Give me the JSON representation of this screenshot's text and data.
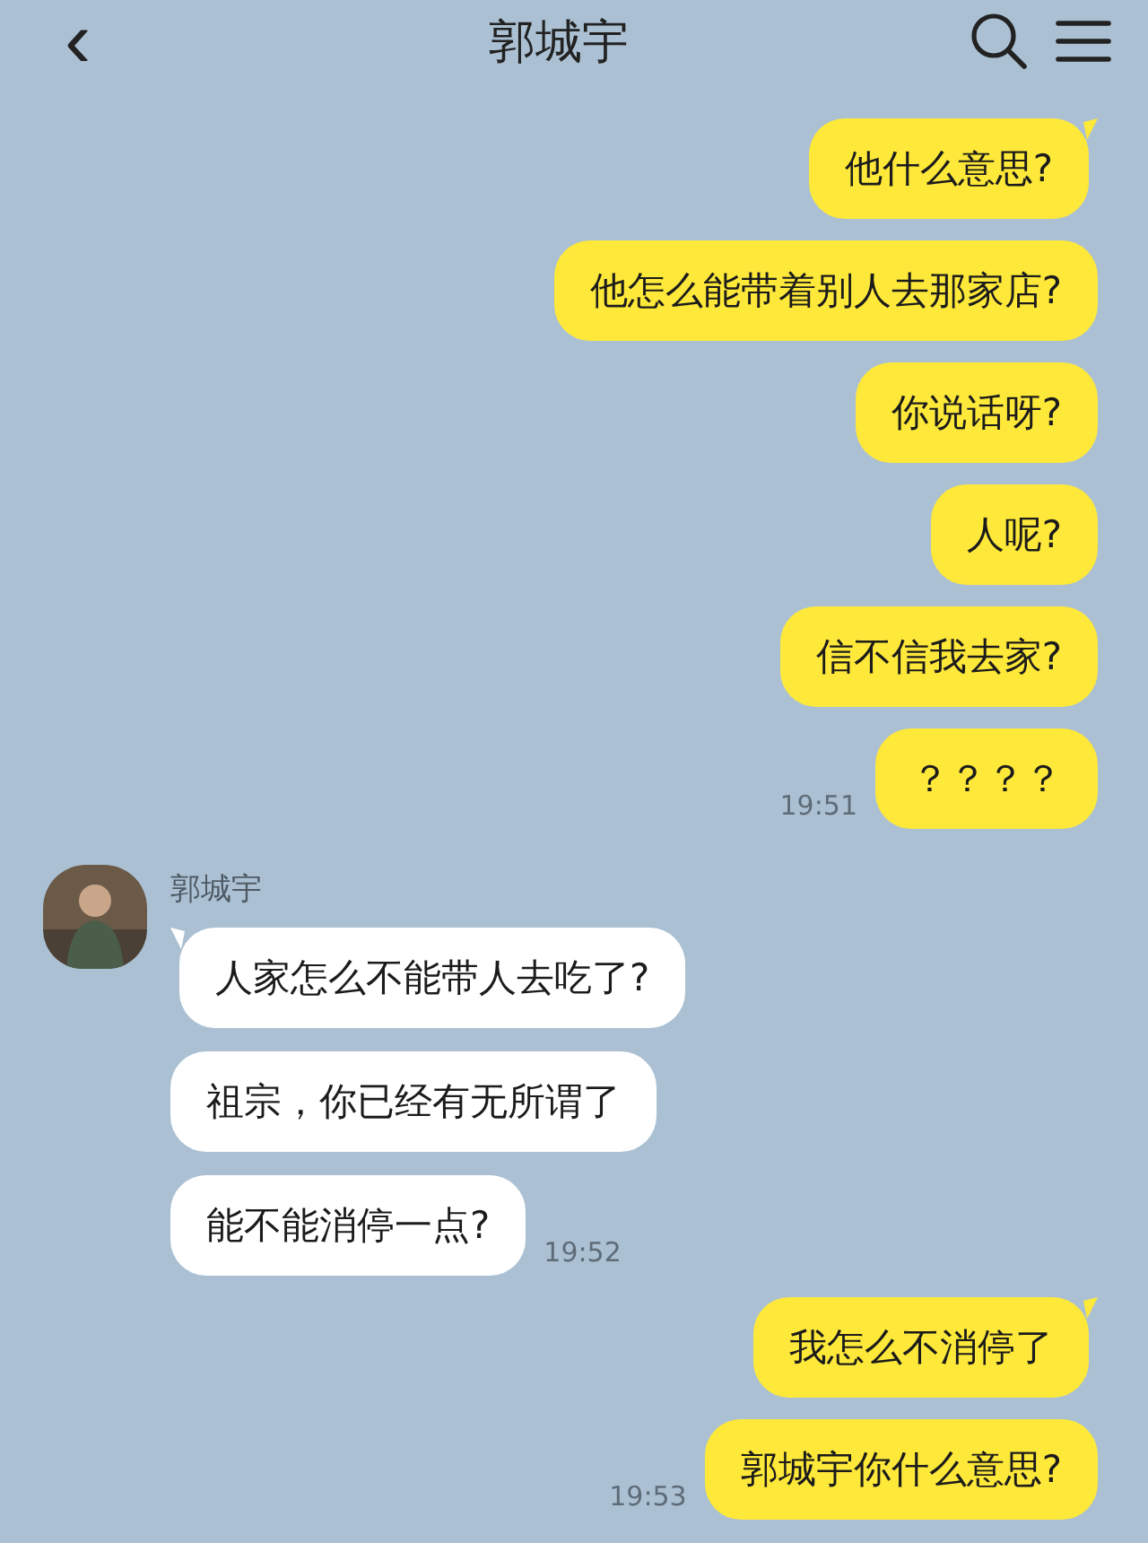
{
  "header": {
    "back": "‹",
    "title": "郭城宇"
  },
  "groups": [
    {
      "kind": "me",
      "time": "19:51",
      "messages": [
        "他什么意思?",
        "他怎么能带着别人去那家店?",
        "你说话呀?",
        "人呢?",
        "信不信我去家?",
        "？？？？"
      ]
    },
    {
      "kind": "them",
      "name": "郭城宇",
      "time": "19:52",
      "messages": [
        "人家怎么不能带人去吃了?",
        "祖宗，你已经有无所谓了",
        "能不能消停一点?"
      ]
    },
    {
      "kind": "me",
      "time": "19:53",
      "messages": [
        "我怎么不消停了",
        "郭城宇你什么意思?"
      ]
    }
  ]
}
